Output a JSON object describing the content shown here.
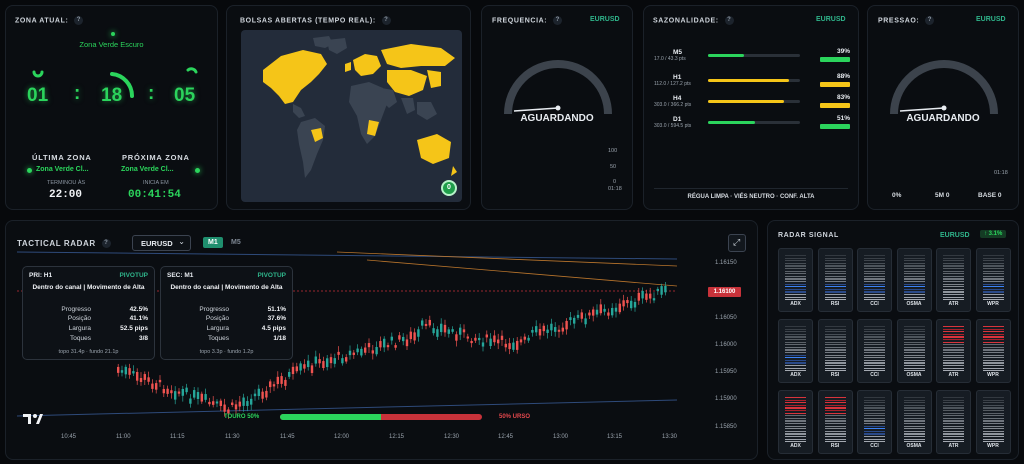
{
  "zona_atual": {
    "title": "ZONA ATUAL:",
    "help": "?",
    "current_zone": "Zona Verde Escuro",
    "timer": {
      "h": "01",
      "m": "18",
      "s": "05",
      "sep": ":"
    },
    "ultima": {
      "title": "ÚLTIMA ZONA",
      "value": "Zona Verde Cl...",
      "label": "TERMINOU ÀS",
      "time": "22:00"
    },
    "proxima": {
      "title": "PRÓXIMA ZONA",
      "value": "Zona Verde Cl...",
      "label": "INICIA EM",
      "time": "00:41:54"
    }
  },
  "bolsas": {
    "title": "BOLSAS ABERTAS (TEMPO REAL):",
    "help": "?",
    "badge": "0"
  },
  "frequencia": {
    "title": "FREQUENCIA:",
    "help": "?",
    "pair": "EURUSD",
    "status": "AGUARDANDO",
    "scale": [
      "100",
      "50",
      "0"
    ],
    "time": "01:18"
  },
  "sazonalidade": {
    "title": "SAZONALIDADE:",
    "help": "?",
    "pair": "EURUSD",
    "rows": [
      {
        "label": "M5",
        "sub": "17.0 / 43.3 pts",
        "pct": "39%",
        "fill": 0.39,
        "color": "#2bd45c"
      },
      {
        "label": "H1",
        "sub": "112.0 / 127.2 pts",
        "pct": "88%",
        "fill": 0.88,
        "color": "#f5c518"
      },
      {
        "label": "H4",
        "sub": "303.0 / 366.2 pts",
        "pct": "83%",
        "fill": 0.83,
        "color": "#f5c518"
      },
      {
        "label": "D1",
        "sub": "303.0 / 594.5 pts",
        "pct": "51%",
        "fill": 0.51,
        "color": "#2bd45c"
      }
    ],
    "footer": "RÉGUA LIMPA · VIÉS NEUTRO · CONF. ALTA"
  },
  "pressao": {
    "title": "PRESSAO:",
    "help": "?",
    "pair": "EURUSD",
    "status": "AGUARDANDO",
    "time": "01:18",
    "footer": [
      "0%",
      "5M 0",
      "BASE 0"
    ]
  },
  "radar": {
    "title": "TACTICAL RADAR",
    "help": "?",
    "symbol": "EURUSD",
    "toggles": [
      "M1",
      "M5"
    ],
    "price_tag": "1.16100",
    "y_labels": [
      "1.16150",
      "1.16050",
      "1.16000",
      "1.15950",
      "1.15900",
      "1.15850"
    ],
    "x_labels": [
      "10:45",
      "11:00",
      "11:15",
      "11:30",
      "11:45",
      "12:00",
      "12:15",
      "12:30",
      "12:45",
      "13:00",
      "13:15",
      "13:30"
    ],
    "bull": "TOURO 50%",
    "bear": "50% URSO",
    "bull_share": 0.5,
    "cards": [
      {
        "hdr": "PRI: H1",
        "tag": "PIVOTUP",
        "desc": "Dentro do canal | Movimento de Alta",
        "rows": [
          [
            "Progresso",
            "42.5%"
          ],
          [
            "Posição",
            "41.1%"
          ],
          [
            "Largura",
            "52.5 pips"
          ],
          [
            "Toques",
            "3/8"
          ]
        ],
        "foot": "topo 31.4p · fundo 21.1p"
      },
      {
        "hdr": "SEC: M1",
        "tag": "PIVOTUP",
        "desc": "Dentro do canal | Movimento de Alta",
        "rows": [
          [
            "Progresso",
            "51.1%"
          ],
          [
            "Posição",
            "37.6%"
          ],
          [
            "Largura",
            "4.5 pips"
          ],
          [
            "Toques",
            "1/18"
          ]
        ],
        "foot": "topo 3.3p · fundo 1.2p"
      }
    ]
  },
  "radar_signal": {
    "title": "RADAR SIGNAL",
    "pair": "EURUSD",
    "badge": "↑ 3.1%",
    "indicators": [
      "ADX",
      "RSI",
      "CCI",
      "OSMA",
      "ATR",
      "WPR"
    ],
    "rows": [
      [
        "blue",
        "blue",
        "blue",
        "blue",
        "none",
        "blue"
      ],
      [
        "blue",
        "none",
        "none",
        "none",
        "red",
        "red"
      ],
      [
        "red",
        "red",
        "blue",
        "none",
        "none",
        "none"
      ]
    ]
  },
  "colors": {
    "accent": "#2bd45c",
    "pair": "#2fb58b",
    "bull": "#2bd45c",
    "bear": "#e5484d",
    "map_open": "#f5c518",
    "price_tag": "#e5484d"
  }
}
